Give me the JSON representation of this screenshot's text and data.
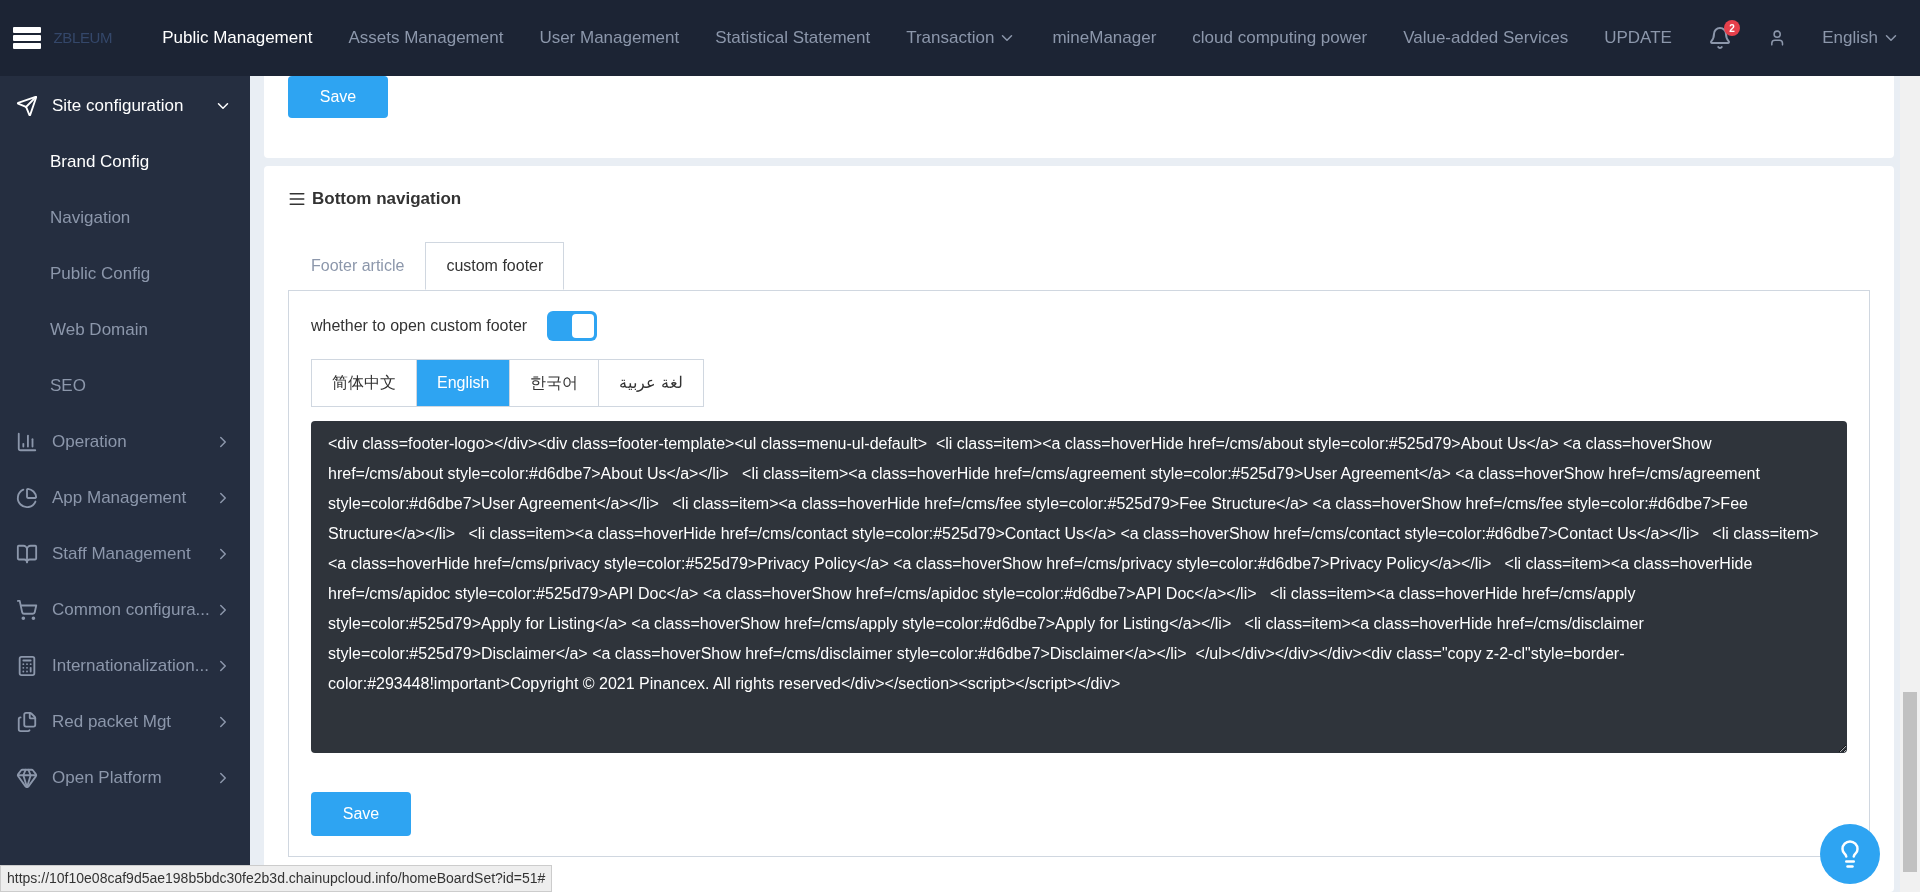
{
  "topbar": {
    "logo": "ZBLEUM",
    "nav": [
      {
        "label": "Public Management",
        "selected": true,
        "dropdown": false
      },
      {
        "label": "Assets Management",
        "selected": false,
        "dropdown": false
      },
      {
        "label": "User Management",
        "selected": false,
        "dropdown": false
      },
      {
        "label": "Statistical Statement",
        "selected": false,
        "dropdown": false
      },
      {
        "label": "Transaction",
        "selected": false,
        "dropdown": true
      },
      {
        "label": "mineManager",
        "selected": false,
        "dropdown": false
      },
      {
        "label": "cloud computing power",
        "selected": false,
        "dropdown": false
      },
      {
        "label": "Value-added Services",
        "selected": false,
        "dropdown": false
      },
      {
        "label": "UPDATE",
        "selected": false,
        "dropdown": false
      }
    ],
    "notifications": "2",
    "language": "English"
  },
  "sidebar": {
    "items": [
      {
        "label": "Site configuration",
        "kind": "send",
        "expanded": true,
        "children": [
          {
            "label": "Brand Config",
            "selected": true
          },
          {
            "label": "Navigation",
            "selected": false
          },
          {
            "label": "Public Config",
            "selected": false
          },
          {
            "label": "Web Domain",
            "selected": false
          },
          {
            "label": "SEO",
            "selected": false
          }
        ]
      },
      {
        "label": "Operation",
        "kind": "chart",
        "expanded": false
      },
      {
        "label": "App Management",
        "kind": "pie",
        "expanded": false
      },
      {
        "label": "Staff Management",
        "kind": "book",
        "expanded": false
      },
      {
        "label": "Common configura...",
        "kind": "cart",
        "expanded": false
      },
      {
        "label": "Internationalization...",
        "kind": "calc",
        "expanded": false
      },
      {
        "label": "Red packet Mgt",
        "kind": "files",
        "expanded": false
      },
      {
        "label": "Open Platform",
        "kind": "gem",
        "expanded": false
      }
    ]
  },
  "top_card": {
    "save": "Save"
  },
  "bottom_navigation": {
    "title": "Bottom navigation",
    "tabs": [
      {
        "label": "Footer article",
        "selected": false
      },
      {
        "label": "custom footer",
        "selected": true
      }
    ],
    "toggle": {
      "label": "whether to open custom footer",
      "on": true
    },
    "languages": [
      {
        "label": "简体中文",
        "selected": false
      },
      {
        "label": "English",
        "selected": true
      },
      {
        "label": "한국어",
        "selected": false
      },
      {
        "label": "لغة عربية",
        "selected": false
      }
    ],
    "code": "<div class=footer-logo></div><div class=footer-template><ul class=menu-ul-default>  <li class=item><a class=hoverHide href=/cms/about style=color:#525d79>About Us</a> <a class=hoverShow href=/cms/about style=color:#d6dbe7>About Us</a></li>   <li class=item><a class=hoverHide href=/cms/agreement style=color:#525d79>User Agreement</a> <a class=hoverShow href=/cms/agreement style=color:#d6dbe7>User Agreement</a></li>   <li class=item><a class=hoverHide href=/cms/fee style=color:#525d79>Fee Structure</a> <a class=hoverShow href=/cms/fee style=color:#d6dbe7>Fee Structure</a></li>   <li class=item><a class=hoverHide href=/cms/contact style=color:#525d79>Contact Us</a> <a class=hoverShow href=/cms/contact style=color:#d6dbe7>Contact Us</a></li>   <li class=item><a class=hoverHide href=/cms/privacy style=color:#525d79>Privacy Policy</a> <a class=hoverShow href=/cms/privacy style=color:#d6dbe7>Privacy Policy</a></li>   <li class=item><a class=hoverHide href=/cms/apidoc style=color:#525d79>API Doc</a> <a class=hoverShow href=/cms/apidoc style=color:#d6dbe7>API Doc</a></li>   <li class=item><a class=hoverHide href=/cms/apply style=color:#525d79>Apply for Listing</a> <a class=hoverShow href=/cms/apply style=color:#d6dbe7>Apply for Listing</a></li>   <li class=item><a class=hoverHide href=/cms/disclaimer style=color:#525d79>Disclaimer</a> <a class=hoverShow href=/cms/disclaimer style=color:#d6dbe7>Disclaimer</a></li>  </ul></div></div></div><div class=\"copy z-2-cl\"style=border-color:#293448!important>Copyright © 2021 Pinancex. All rights reserved</div></section><script></script></div>",
    "save": "Save"
  },
  "status_url": "https://10f10e08caf9d5ae198b5bdc30fe2b3d.chainupcloud.info/homeBoardSet?id=51#"
}
